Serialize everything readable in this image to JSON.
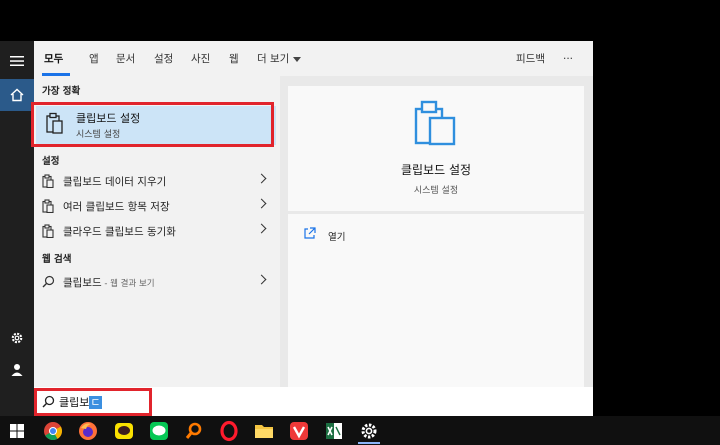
{
  "tabs": [
    "모두",
    "앱",
    "문서",
    "설정",
    "사진",
    "웹",
    "더 보기"
  ],
  "header_right": {
    "feedback": "피드백",
    "more": "···"
  },
  "best_match": {
    "section": "가장 정확",
    "title": "클립보드 설정",
    "subtitle": "시스템 설정"
  },
  "settings": {
    "section": "설정",
    "items": [
      "클립보드 데이터 지우기",
      "여러 클립보드 항목 저장",
      "클라우드 클립보드 동기화"
    ]
  },
  "web": {
    "section": "웹 검색",
    "query": "클립보드",
    "suffix": " - 웹 결과 보기"
  },
  "detail": {
    "title": "클립보드 설정",
    "subtitle": "시스템 설정",
    "action": "열기"
  },
  "search": {
    "typed": "클립보",
    "composing": "ㄷ"
  },
  "colors": {
    "accent": "#1a73e8",
    "selected_bg": "#cce4f7",
    "highlight_frame": "#e1242c",
    "clipboard_icon": "#2f8fde"
  },
  "icons": {
    "rail": [
      "hamburger-menu-icon",
      "home-icon",
      "settings-gear-icon",
      "user-account-icon"
    ],
    "taskbar": [
      "windows-start-icon",
      "chrome-icon",
      "firefox-icon",
      "kakaotalk-icon",
      "line-icon",
      "search-app-icon",
      "opera-icon",
      "file-explorer-icon",
      "vivaldi-icon",
      "excel-icon",
      "settings-icon"
    ]
  }
}
